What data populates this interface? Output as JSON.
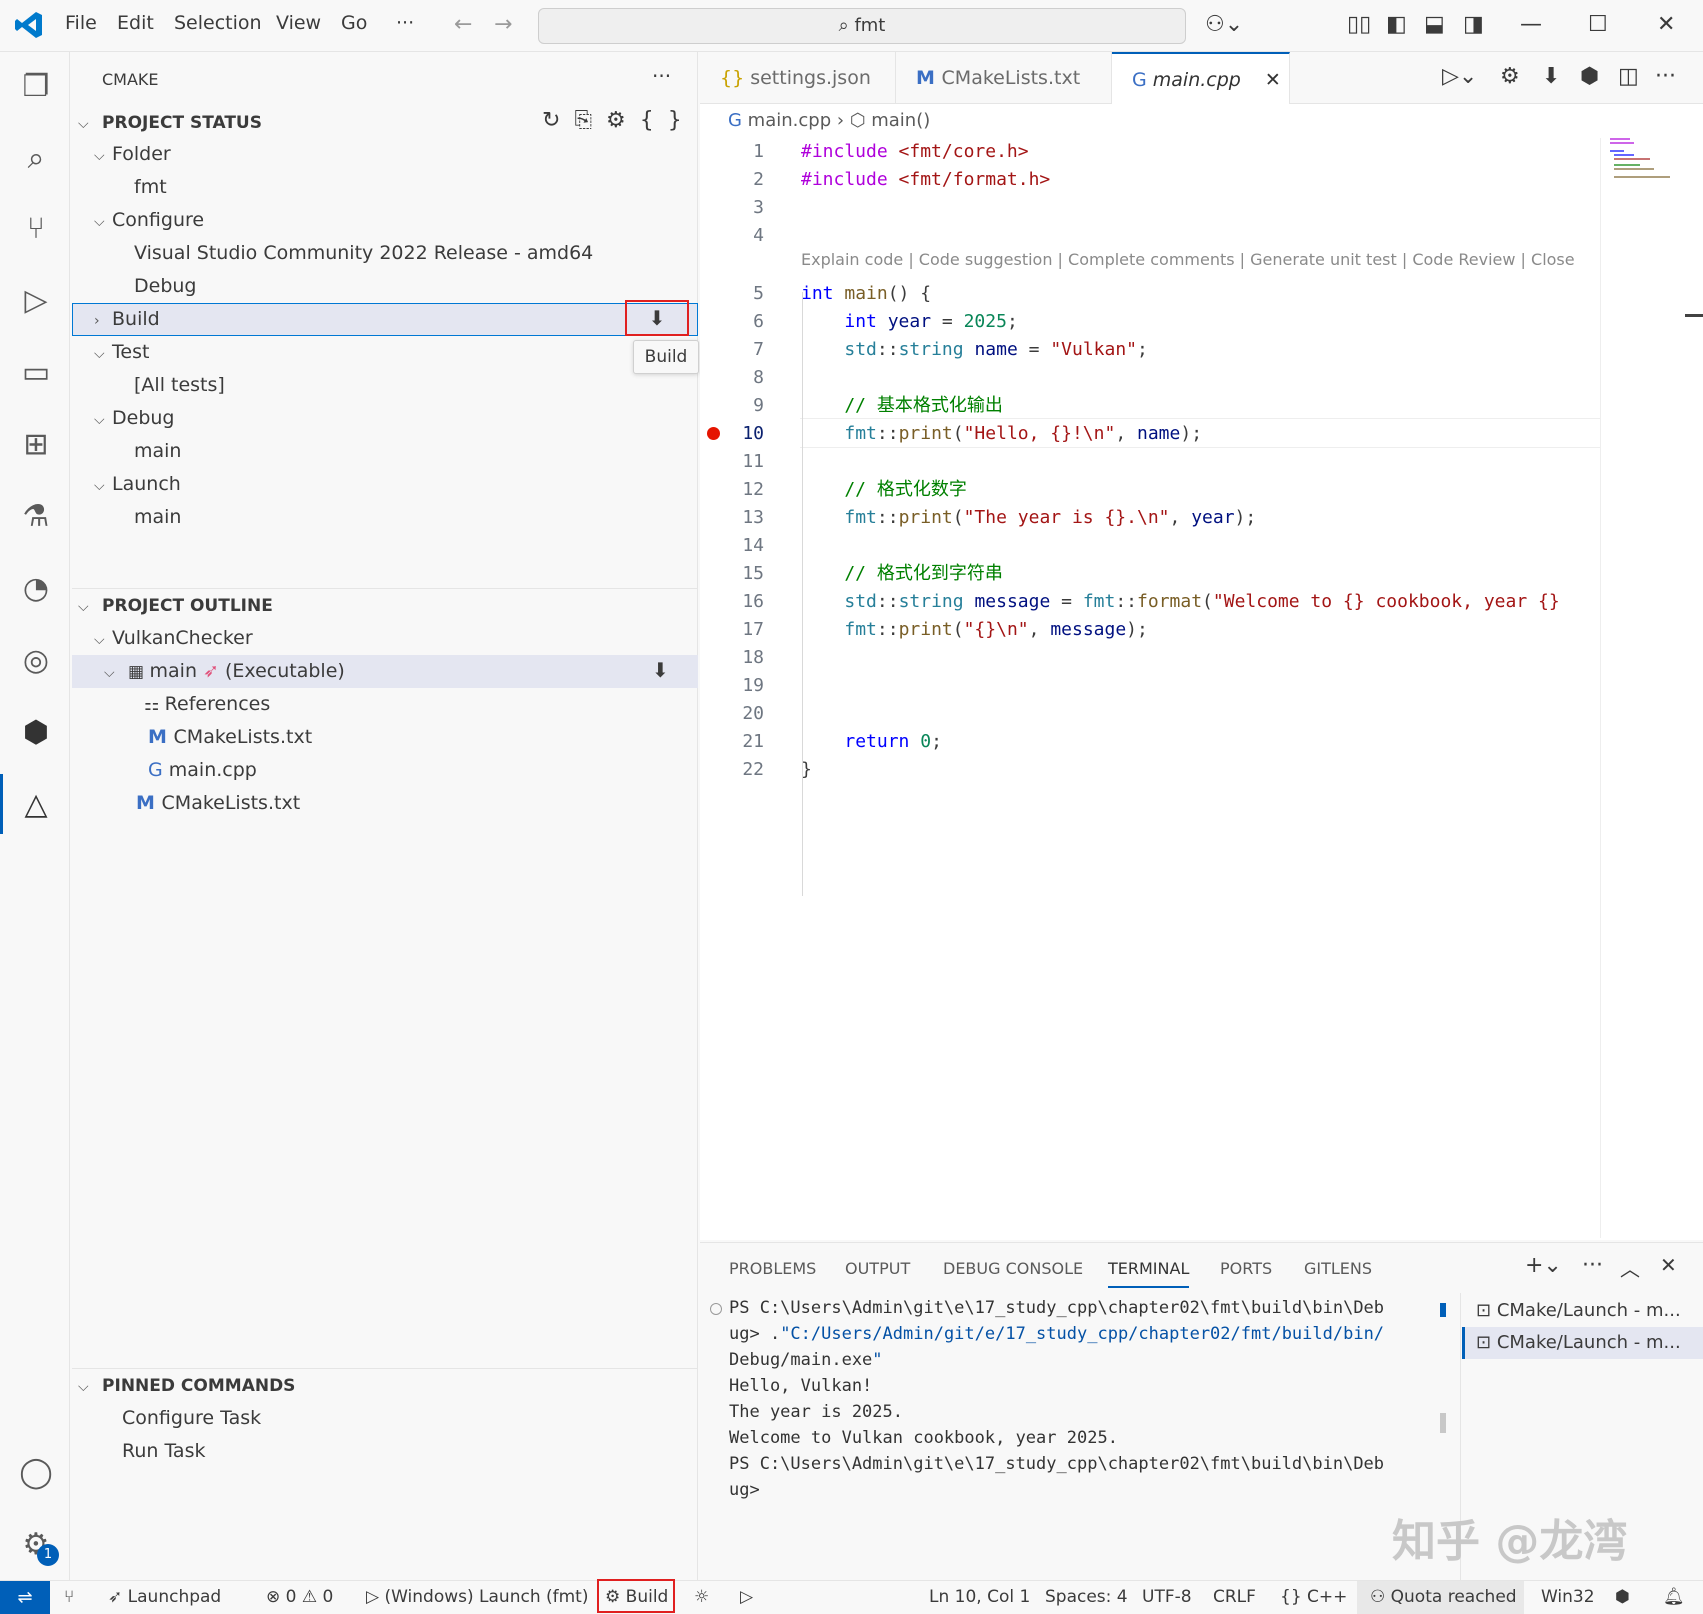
{
  "menu": {
    "file": "File",
    "edit": "Edit",
    "selection": "Selection",
    "view": "View",
    "go": "Go",
    "more": "···"
  },
  "search": {
    "text": "fmt"
  },
  "sidebar": {
    "title": "CMAKE",
    "project_status": {
      "title": "PROJECT STATUS",
      "folder": "Folder",
      "folder_value": "fmt",
      "configure": "Configure",
      "configure_value": "Visual Studio Community 2022 Release - amd64",
      "configure_mode": "Debug",
      "build": "Build",
      "build_tooltip": "Build",
      "test": "Test",
      "test_value": "[All tests]",
      "debug": "Debug",
      "debug_value": "main",
      "launch": "Launch",
      "launch_value": "main"
    },
    "project_outline": {
      "title": "PROJECT OUTLINE",
      "project": "VulkanChecker",
      "target": "main",
      "target_kind": "(Executable)",
      "items": [
        "References",
        "CMakeLists.txt",
        "main.cpp"
      ],
      "root_file": "CMakeLists.txt"
    },
    "pinned": {
      "title": "PINNED COMMANDS",
      "items": [
        "Configure Task",
        "Run Task"
      ]
    }
  },
  "tabs": [
    {
      "label": "settings.json"
    },
    {
      "label": "CMakeLists.txt"
    },
    {
      "label": "main.cpp"
    }
  ],
  "breadcrumb": {
    "file": "main.cpp",
    "symbol": "main()"
  },
  "codelens": "Explain code | Code suggestion | Complete comments | Generate unit test | Code Review | Close",
  "code_lines": [
    "#include <fmt/core.h>",
    "#include <fmt/format.h>",
    "",
    "",
    "int main() {",
    "    int year = 2025;",
    "    std::string name = \"Vulkan\";",
    "",
    "    // 基本格式化输出",
    "    fmt::print(\"Hello, {}!\\n\", name);",
    "",
    "    // 格式化数字",
    "    fmt::print(\"The year is {}.\\n\", year);",
    "",
    "    // 格式化到字符串",
    "    std::string message = fmt::format(\"Welcome to {} cookbook, year {}",
    "    fmt::print(\"{}\\n\", message);",
    "",
    "",
    "",
    "    return 0;",
    "}"
  ],
  "line_numbers": [
    "1",
    "2",
    "3",
    "4",
    "5",
    "6",
    "7",
    "8",
    "9",
    "10",
    "11",
    "12",
    "13",
    "14",
    "15",
    "16",
    "17",
    "18",
    "19",
    "20",
    "21",
    "22"
  ],
  "panel": {
    "tabs": [
      "PROBLEMS",
      "OUTPUT",
      "DEBUG CONSOLE",
      "TERMINAL",
      "PORTS",
      "GITLENS"
    ],
    "terminal_lines": [
      "PS C:\\Users\\Admin\\git\\e\\17_study_cpp\\chapter02\\fmt\\build\\bin\\Deb",
      "ug> .\"C:/Users/Admin/git/e/17_study_cpp/chapter02/fmt/build/bin/",
      "Debug/main.exe\"",
      "Hello, Vulkan!",
      "The year is 2025.",
      "Welcome to Vulkan cookbook, year 2025.",
      "PS C:\\Users\\Admin\\git\\e\\17_study_cpp\\chapter02\\fmt\\build\\bin\\Deb",
      "ug>"
    ],
    "terminals": [
      "CMake/Launch - m...",
      "CMake/Launch - m..."
    ]
  },
  "status": {
    "launchpad": "Launchpad",
    "errors": "0",
    "warnings": "0",
    "launch": "(Windows) Launch (fmt)",
    "build": "Build",
    "position": "Ln 10, Col 1",
    "spaces": "Spaces: 4",
    "encoding": "UTF-8",
    "eol": "CRLF",
    "language": "C++",
    "quota": "Quota reached",
    "platform": "Win32"
  },
  "watermark": "知乎 @龙湾"
}
